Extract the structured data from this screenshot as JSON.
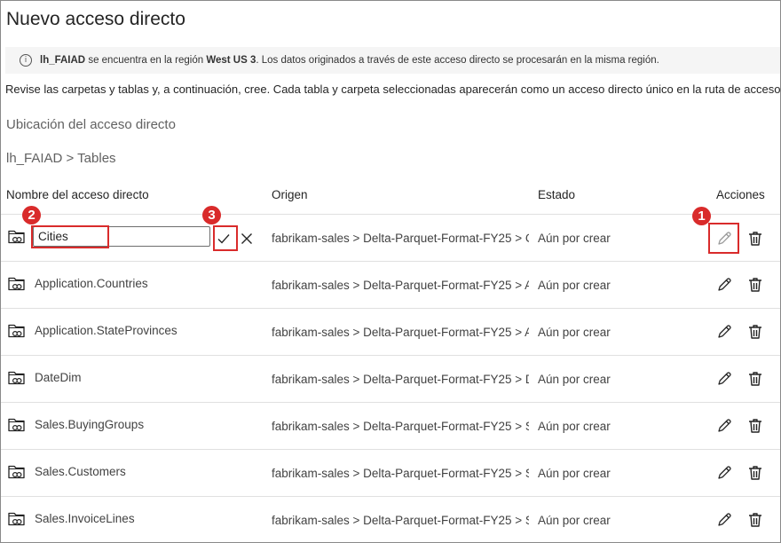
{
  "dialog": {
    "title": "Nuevo acceso directo"
  },
  "banner": {
    "icon": "info-icon",
    "lakehouse": "lh_FAIAD",
    "text_1": " se encuentra en la región ",
    "region": "West US 3",
    "text_2": ". Los datos originados a través de este acceso directo se procesarán en la misma región."
  },
  "description": "Revise las carpetas y tablas y, a continuación, cree. Cada tabla y carpeta seleccionadas aparecerán como un acceso directo único en la ruta de acceso",
  "location": {
    "heading": "Ubicación del acceso directo",
    "breadcrumb": "lh_FAIAD > Tables"
  },
  "table": {
    "headers": {
      "name": "Nombre del acceso directo",
      "origin": "Origen",
      "status": "Estado",
      "actions": "Acciones"
    },
    "editing_row": {
      "input_value": "Cities",
      "origin": "fabrikam-sales > Delta-Parquet-Format-FY25 > Cities",
      "status": "Aún por crear"
    },
    "rows": [
      {
        "name": "Application.Countries",
        "origin": "fabrikam-sales > Delta-Parquet-Format-FY25 > Application.Countries",
        "status": "Aún por crear"
      },
      {
        "name": "Application.StateProvinces",
        "origin": "fabrikam-sales > Delta-Parquet-Format-FY25 > Application.StateProvinces",
        "status": "Aún por crear"
      },
      {
        "name": "DateDim",
        "origin": "fabrikam-sales > Delta-Parquet-Format-FY25 > DateDim",
        "status": "Aún por crear"
      },
      {
        "name": "Sales.BuyingGroups",
        "origin": "fabrikam-sales > Delta-Parquet-Format-FY25 > Sales.BuyingGroups",
        "status": "Aún por crear"
      },
      {
        "name": "Sales.Customers",
        "origin": "fabrikam-sales > Delta-Parquet-Format-FY25 > Sales.Customers",
        "status": "Aún por crear"
      },
      {
        "name": "Sales.InvoiceLines",
        "origin": "fabrikam-sales > Delta-Parquet-Format-FY25 > Sales.InvoiceLines",
        "status": "Aún por crear"
      }
    ]
  },
  "callouts": [
    "1",
    "2",
    "3"
  ],
  "colors": {
    "callout": "#d92b2b",
    "banner_bg": "#f5f5f5",
    "divider": "#e0e0e0"
  }
}
